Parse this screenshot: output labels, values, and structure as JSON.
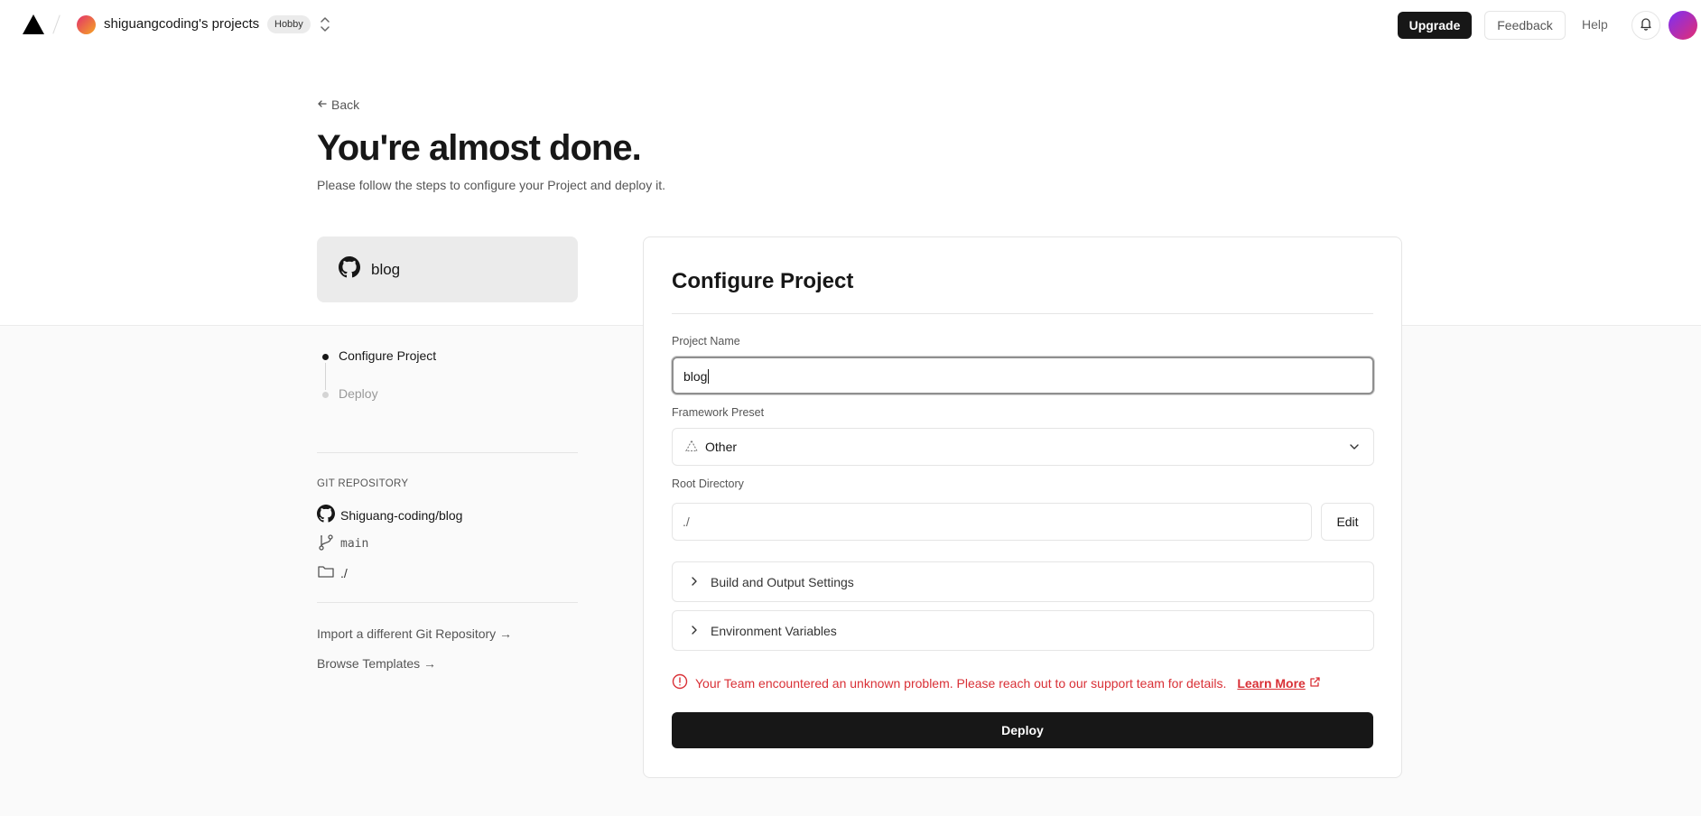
{
  "header": {
    "team_name": "shiguangcoding's projects",
    "plan": "Hobby",
    "upgrade_label": "Upgrade",
    "feedback_label": "Feedback",
    "help_label": "Help"
  },
  "page": {
    "back_label": "Back",
    "title": "You're almost done.",
    "subtitle": "Please follow the steps to configure your Project and deploy it."
  },
  "repo_card": {
    "name": "blog"
  },
  "steps": [
    {
      "label": "Configure Project",
      "active": true
    },
    {
      "label": "Deploy",
      "active": false
    }
  ],
  "git": {
    "heading": "GIT REPOSITORY",
    "repo": "Shiguang-coding/blog",
    "branch": "main",
    "directory": "./"
  },
  "links": {
    "import_other": "Import a different Git Repository →",
    "browse_templates": "Browse Templates →"
  },
  "configure": {
    "title": "Configure Project",
    "project_name_label": "Project Name",
    "project_name_value": "blog",
    "framework_label": "Framework Preset",
    "framework_value": "Other",
    "root_label": "Root Directory",
    "root_value": "./",
    "edit_label": "Edit",
    "build_settings_label": "Build and Output Settings",
    "env_vars_label": "Environment Variables",
    "error_text": "Your Team encountered an unknown problem. Please reach out to our support team for details.",
    "learn_more_label": "Learn More",
    "deploy_label": "Deploy"
  },
  "colors": {
    "accent_dark": "#171717",
    "error": "#d93036",
    "page_bg": "#fafafa"
  },
  "icons": [
    "vercel-logo-icon",
    "chevron-updown-icon",
    "bell-icon",
    "arrow-left-icon",
    "github-icon",
    "git-branch-icon",
    "folder-icon",
    "triangle-outline-icon",
    "chevron-down-icon",
    "chevron-right-icon",
    "alert-circle-icon",
    "external-link-icon"
  ]
}
